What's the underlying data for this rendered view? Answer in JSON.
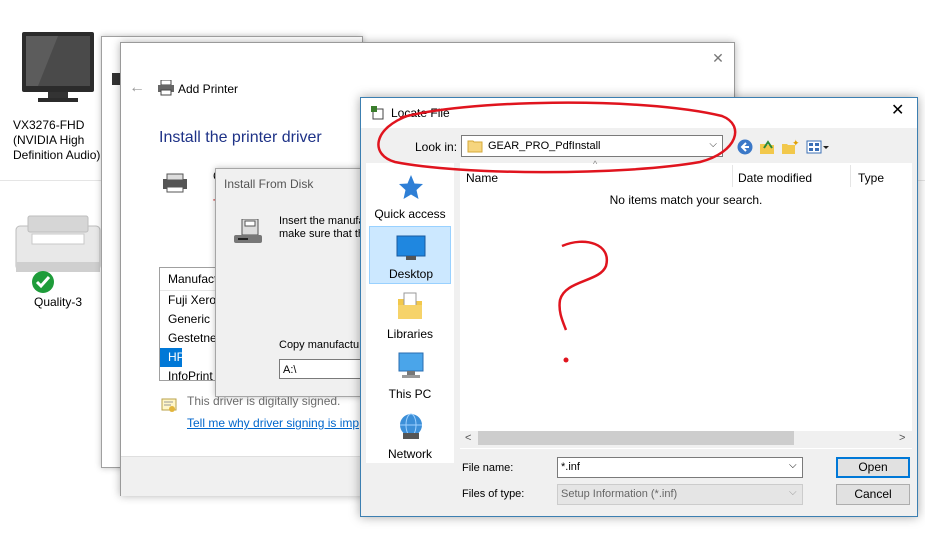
{
  "devices": {
    "monitor_label_lines": [
      "VX3276-FHD",
      "(NVIDIA High",
      "Definition Audio)"
    ],
    "printer_label": "Quality-3"
  },
  "add_printer": {
    "window_title": "Add Printer",
    "heading": "Install the printer driver",
    "manufacturer_header": "Manufact",
    "manufacturers": [
      "Fuji Xerox",
      "Generic",
      "Gestetner",
      "HP",
      "InfoPrint"
    ],
    "selected_manufacturer": "HP",
    "signed_text": "This driver is digitally signed.",
    "signing_link": "Tell me why driver signing is imp",
    "stray_c": "C",
    "stray_t": "T"
  },
  "install_from_disk": {
    "title": "Install From Disk",
    "instruction_line1": "Insert the manufa",
    "instruction_line2": "make sure that th",
    "copy_label": "Copy manufactu",
    "copy_value": "A:\\"
  },
  "locate_file": {
    "title": "Locate File",
    "look_in_label": "Look in:",
    "look_in_value": "GEAR_PRO_PdfInstall",
    "nav_items": [
      {
        "label": "Quick access",
        "icon": "star-icon"
      },
      {
        "label": "Desktop",
        "icon": "desktop-icon"
      },
      {
        "label": "Libraries",
        "icon": "libraries-icon"
      },
      {
        "label": "This PC",
        "icon": "computer-icon"
      },
      {
        "label": "Network",
        "icon": "network-icon"
      }
    ],
    "selected_nav": "Desktop",
    "columns": [
      "Name",
      "Date modified",
      "Type"
    ],
    "empty_message": "No items match your search.",
    "file_name_label": "File name:",
    "file_name_value": "*.inf",
    "file_type_label": "Files of type:",
    "file_type_value": "Setup Information (*.inf)",
    "open_button": "Open",
    "cancel_button": "Cancel"
  },
  "annotation_color": "#e0141e",
  "accent_color": "#0078d7"
}
